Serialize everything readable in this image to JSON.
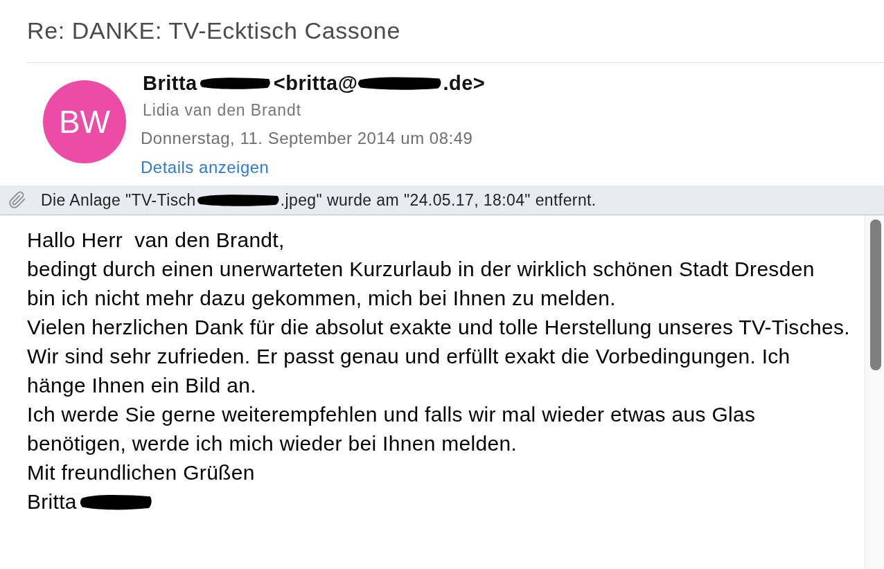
{
  "subject": "Re: DANKE: TV-Ecktisch Cassone",
  "sender": {
    "initials": "BW",
    "name": "Britta",
    "name_redacted": true,
    "email_start": "<britta@",
    "email_redacted": true,
    "email_end": ".de>",
    "recipient": "Lidia van den Brandt",
    "date": "Donnerstag, 11. September 2014 um 08:49",
    "details_link": "Details anzeigen"
  },
  "attachment_notice": {
    "text_before": "Die Anlage \"TV-Tisch",
    "redacted": true,
    "text_after": ".jpeg\" wurde am \"24.05.17, 18:04\" entfernt."
  },
  "body": {
    "paragraphs": [
      {
        "lines": [
          "Hallo Herr  van den Brandt,"
        ]
      },
      {
        "lines": [
          "bedingt durch einen unerwarteten Kurzurlaub in der wirklich schönen Stadt Dresden",
          "bin ich nicht mehr dazu gekommen, mich bei Ihnen zu melden."
        ]
      },
      {
        "lines": [
          "Vielen herzlichen Dank für die absolut exakte und tolle Herstellung unseres TV-Tisches."
        ]
      },
      {
        "lines": [
          "Wir sind sehr zufrieden. Er passt genau und erfüllt exakt die Vorbedingungen. Ich",
          "hänge Ihnen ein Bild an."
        ]
      },
      {
        "lines": [
          "Ich werde Sie gerne weiterempfehlen und falls wir mal wieder etwas aus Glas",
          "benötigen, werde ich mich wieder bei Ihnen melden."
        ]
      },
      {
        "lines": [
          "Mit freundlichen Grüßen"
        ]
      }
    ],
    "signature": {
      "name": "Britta",
      "redacted": true
    }
  }
}
